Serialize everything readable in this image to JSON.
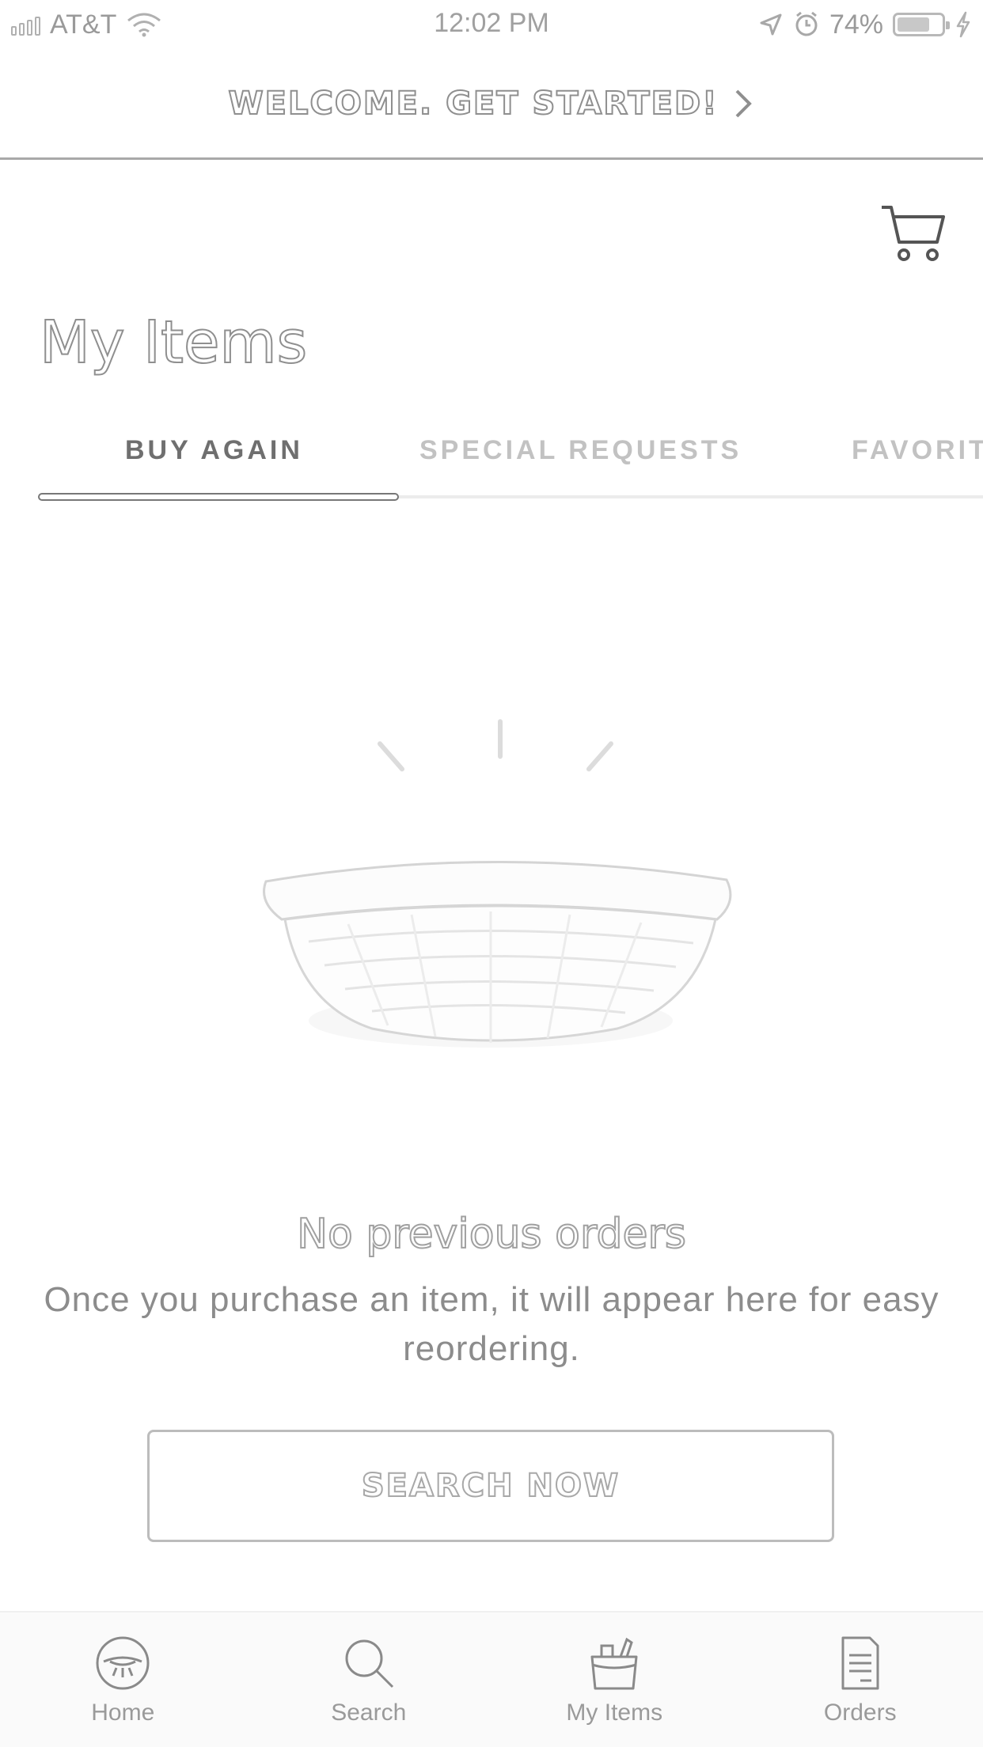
{
  "status_bar": {
    "carrier": "AT&T",
    "time": "12:02 PM",
    "battery_percent": "74%",
    "battery_level": 0.74,
    "icons": [
      "signal-icon",
      "wifi-icon",
      "location-arrow-icon",
      "alarm-icon",
      "battery-icon",
      "charging-bolt-icon"
    ]
  },
  "banner": {
    "text": "WELCOME. GET STARTED!",
    "icon": "chevron-right-icon"
  },
  "header": {
    "cart_icon": "cart-icon",
    "title": "My Items"
  },
  "tabs": [
    {
      "label": "BUY AGAIN",
      "active": true
    },
    {
      "label": "SPECIAL REQUESTS",
      "active": false
    },
    {
      "label": "FAVORIT",
      "active": false
    }
  ],
  "empty_state": {
    "illustration": "empty-basket-illustration",
    "title": "No previous orders",
    "message": "Once you purchase an item, it will appear here for easy reordering.",
    "button_label": "SEARCH NOW"
  },
  "bottom_nav": [
    {
      "label": "Home",
      "icon": "home-icon"
    },
    {
      "label": "Search",
      "icon": "search-icon"
    },
    {
      "label": "My Items",
      "icon": "bag-icon"
    },
    {
      "label": "Orders",
      "icon": "receipt-icon"
    }
  ]
}
